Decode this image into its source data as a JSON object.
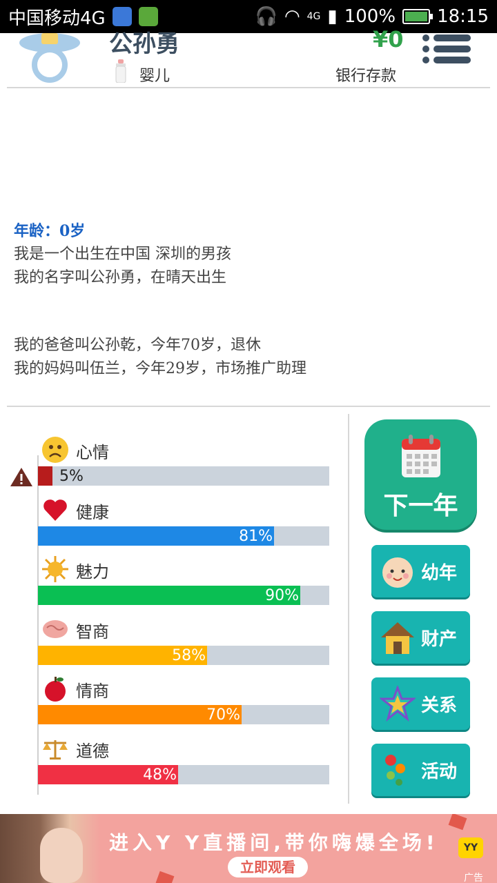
{
  "status_bar": {
    "carrier": "中国移动4G",
    "network": "4G",
    "battery": "100%",
    "time": "18:15"
  },
  "header": {
    "name": "公孙勇",
    "money": "¥0",
    "stage": "婴儿",
    "bank_label": "银行存款"
  },
  "story": {
    "age": "年龄：0岁",
    "line1": "我是一个出生在中国 深圳的男孩",
    "line2": "我的名字叫公孙勇，在晴天出生",
    "line3": "我的爸爸叫公孙乾，今年70岁，退休",
    "line4": "我的妈妈叫伍兰，今年29岁，市场推广助理"
  },
  "stats": [
    {
      "label": "心情",
      "percent": 5,
      "text": "5%",
      "color": "#b71c1c",
      "icon": "sad-face-icon"
    },
    {
      "label": "健康",
      "percent": 81,
      "text": "81%",
      "color": "#1e88e5",
      "icon": "heart-icon"
    },
    {
      "label": "魅力",
      "percent": 90,
      "text": "90%",
      "color": "#0abf53",
      "icon": "sun-icon"
    },
    {
      "label": "智商",
      "percent": 58,
      "text": "58%",
      "color": "#ffb300",
      "icon": "brain-icon"
    },
    {
      "label": "情商",
      "percent": 70,
      "text": "70%",
      "color": "#ff8a00",
      "icon": "apple-icon"
    },
    {
      "label": "道德",
      "percent": 48,
      "text": "48%",
      "color": "#f03044",
      "icon": "scales-icon"
    }
  ],
  "actions": {
    "next_year": "下一年",
    "childhood": "幼年",
    "property": "财产",
    "relations": "关系",
    "activities": "活动"
  },
  "ad": {
    "headline": "进入Y Y直播间,带你嗨爆全场!",
    "cta": "立即观看",
    "logo": "YY",
    "tag": "广告"
  }
}
